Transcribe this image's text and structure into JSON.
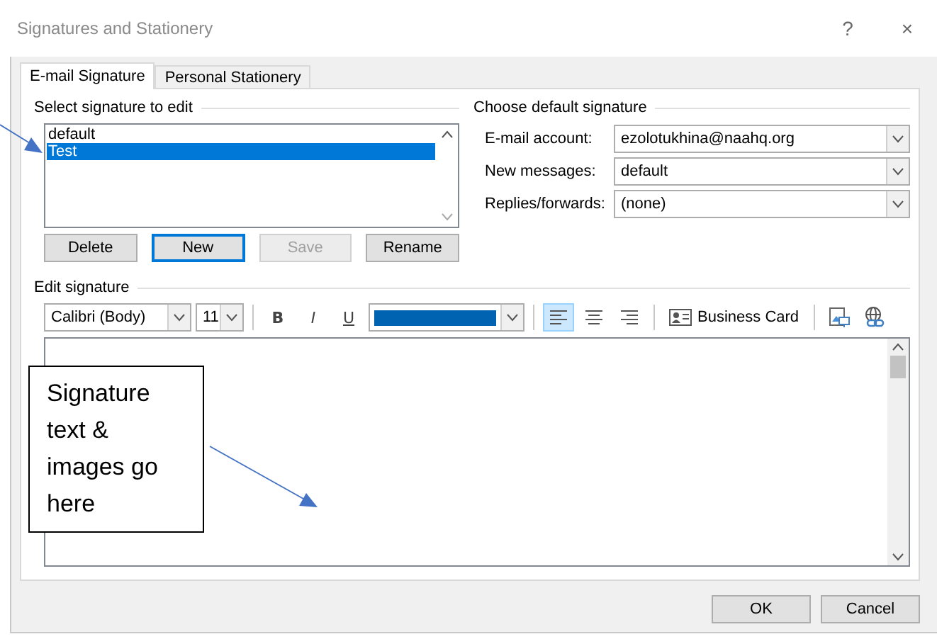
{
  "window": {
    "title": "Signatures and Stationery",
    "help": "?",
    "close": "×"
  },
  "tabs": [
    {
      "label": "E-mail Signature",
      "selected": true
    },
    {
      "label": "Personal Stationery",
      "selected": false
    }
  ],
  "select_signature": {
    "heading": "Select signature to edit",
    "items": [
      {
        "label": "default",
        "selected": false
      },
      {
        "label": "Test",
        "selected": true
      }
    ],
    "buttons": [
      {
        "label": "Delete",
        "disabled": false,
        "focused": false
      },
      {
        "label": "New",
        "disabled": false,
        "focused": true
      },
      {
        "label": "Save",
        "disabled": true,
        "focused": false
      },
      {
        "label": "Rename",
        "disabled": false,
        "focused": false
      }
    ]
  },
  "default_signature": {
    "heading": "Choose default signature",
    "fields": [
      {
        "label": "E-mail account:",
        "value": "ezolotukhina@naahq.org"
      },
      {
        "label": "New messages:",
        "value": "default"
      },
      {
        "label": "Replies/forwards:",
        "value": "(none)"
      }
    ]
  },
  "edit_signature": {
    "heading": "Edit signature",
    "font": "Calibri (Body)",
    "size": "11",
    "format_buttons": [
      {
        "label": "B",
        "kind": "bold"
      },
      {
        "label": "I",
        "kind": "italic"
      },
      {
        "label": "U",
        "kind": "underline"
      }
    ],
    "color": "#0063b1",
    "align_buttons": [
      {
        "kind": "left",
        "selected": true
      },
      {
        "kind": "center",
        "selected": false
      },
      {
        "kind": "right",
        "selected": false
      }
    ],
    "business_card": "Business Card"
  },
  "callout": {
    "text": "Signature text & images go here"
  },
  "buttons": [
    "OK",
    "Cancel"
  ]
}
